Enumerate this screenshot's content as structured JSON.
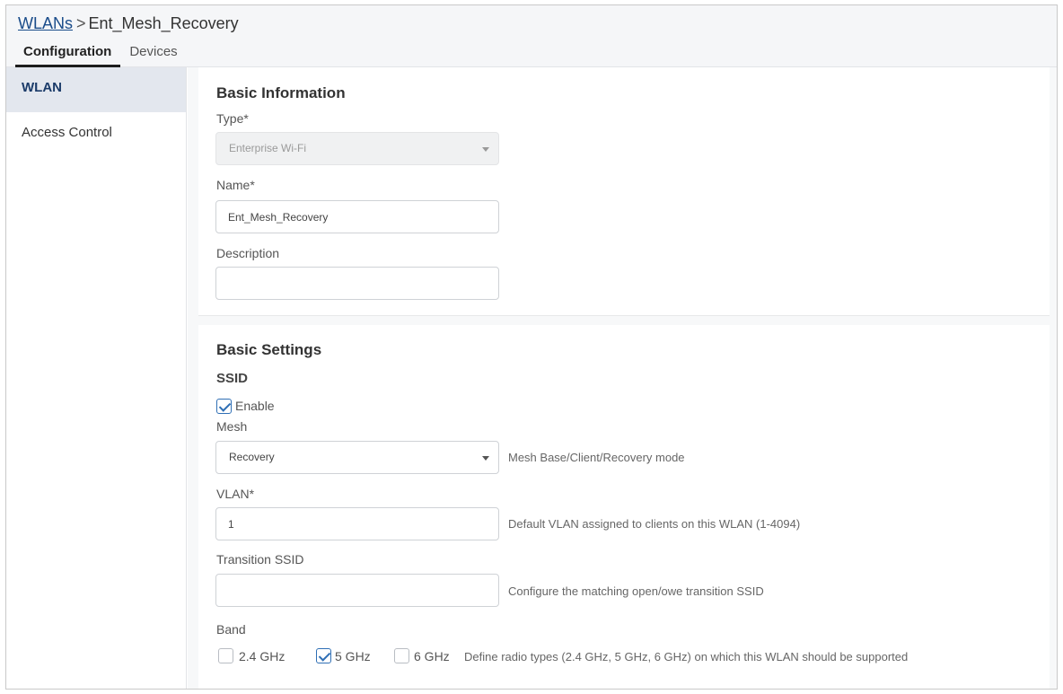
{
  "breadcrumb": {
    "parent": "WLANs",
    "separator": ">",
    "current": "Ent_Mesh_Recovery"
  },
  "tabs": [
    {
      "label": "Configuration",
      "active": true
    },
    {
      "label": "Devices",
      "active": false
    }
  ],
  "sidebar": {
    "items": [
      {
        "label": "WLAN",
        "active": true
      },
      {
        "label": "Access Control",
        "active": false
      }
    ]
  },
  "basic_information": {
    "title": "Basic Information",
    "type_label": "Type*",
    "type_value": "Enterprise Wi-Fi",
    "name_label": "Name*",
    "name_value": "Ent_Mesh_Recovery",
    "description_label": "Description",
    "description_value": ""
  },
  "basic_settings": {
    "title": "Basic Settings",
    "ssid_heading": "SSID",
    "enable_label": "Enable",
    "enable_checked": true,
    "mesh_label": "Mesh",
    "mesh_value": "Recovery",
    "mesh_hint": "Mesh Base/Client/Recovery mode",
    "vlan_label": "VLAN*",
    "vlan_value": "1",
    "vlan_hint": "Default VLAN assigned to clients on this WLAN (1-4094)",
    "transition_label": "Transition SSID",
    "transition_value": "",
    "transition_hint": "Configure the matching open/owe transition SSID",
    "band_label": "Band",
    "bands": [
      {
        "label": "2.4 GHz",
        "checked": false
      },
      {
        "label": "5 GHz",
        "checked": true
      },
      {
        "label": "6 GHz",
        "checked": false
      }
    ],
    "band_hint": "Define radio types (2.4 GHz, 5 GHz, 6 GHz) on which this WLAN should be supported"
  },
  "colors": {
    "link": "#1a4c8a",
    "checkbox_accent": "#2f6fb5",
    "nav_active_bg": "#e3e7ee"
  },
  "icons": {
    "dropdown": "chevron-down-icon",
    "checkbox": "checkmark-icon"
  }
}
